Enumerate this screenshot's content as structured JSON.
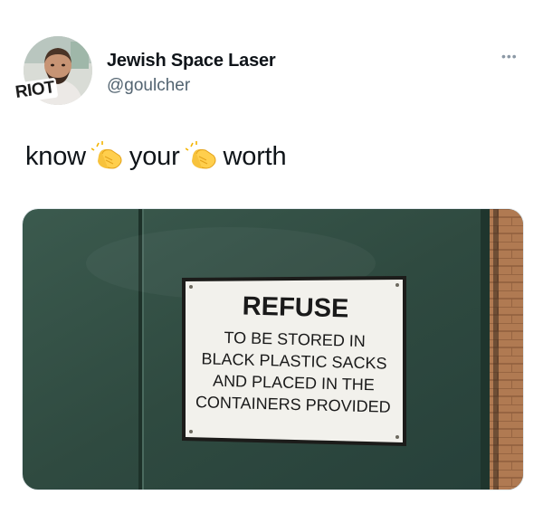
{
  "author": {
    "display_name": "Jewish Space Laser",
    "handle": "@goulcher",
    "avatar_shirt_text": "RIOT"
  },
  "tweet": {
    "words": [
      "know",
      "your",
      "worth"
    ],
    "emoji": "clapping-hands"
  },
  "more_menu": "•••",
  "photo": {
    "sign_title": "REFUSE",
    "sign_lines": [
      "TO BE STORED IN",
      "BLACK PLASTIC SACKS",
      "AND PLACED IN THE",
      "CONTAINERS PROVIDED"
    ],
    "colors": {
      "door": "#2f4a40",
      "sign": "#f2f1ec",
      "brick": "#b07a52"
    }
  }
}
